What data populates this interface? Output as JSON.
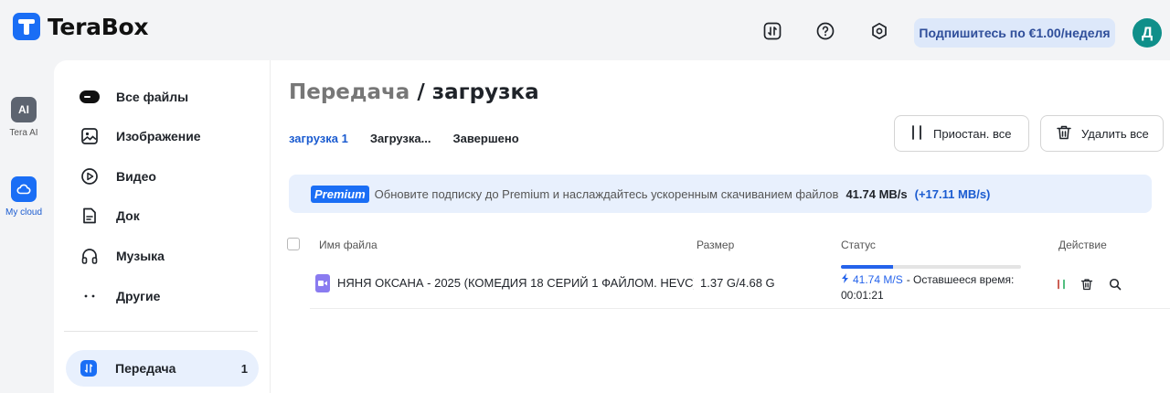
{
  "header": {
    "brand": "TeraBox",
    "subscribe_label": "Подпишитесь по €1.00/неделя",
    "avatar_initial": "Д"
  },
  "rail": {
    "ai_glyph": "AI",
    "ai_label": "Tera AI",
    "cloud_label": "My cloud"
  },
  "sidebar": {
    "items": [
      {
        "label": "Все файлы",
        "icon": "all-files-icon"
      },
      {
        "label": "Изображение",
        "icon": "image-icon"
      },
      {
        "label": "Видео",
        "icon": "video-icon"
      },
      {
        "label": "Док",
        "icon": "document-icon"
      },
      {
        "label": "Музыка",
        "icon": "music-icon"
      },
      {
        "label": "Другие",
        "icon": "more-icon"
      }
    ],
    "transfer": {
      "label": "Передача",
      "count": "1"
    }
  },
  "main": {
    "title_part1": "Передача",
    "title_sep": " / ",
    "title_part2": "загрузка",
    "tabs": [
      "загрузка 1",
      "Загрузка...",
      "Завершено"
    ],
    "pause_all_label": "Приостан. все",
    "delete_all_label": "Удалить все",
    "promo": {
      "badge": "Premium",
      "text": "Обновите подписку до Premium и наслаждайтесь ускоренным скачиванием файлов",
      "speed": "41.74 MB/s",
      "boost": "(+17.11 MB/s)"
    },
    "columns": [
      "Имя файла",
      "Размер",
      "Статус",
      "Действие"
    ],
    "rows": [
      {
        "name": "НЯНЯ ОКСАНА - 2025 (КОМЕДИЯ 18 СЕРИЙ 1 ФАЙЛОМ. HEVC)....",
        "size": "1.37 G/4.68 G",
        "progress": 0.29,
        "speed": "41.74 M/S",
        "remaining_label": "- Оставшееся время:",
        "remaining_time": "00:01:21"
      }
    ]
  },
  "colors": {
    "accent": "#1a6ef5",
    "link": "#1a5bd0",
    "avatar": "#0f8f8a",
    "progress": "#2563eb"
  }
}
